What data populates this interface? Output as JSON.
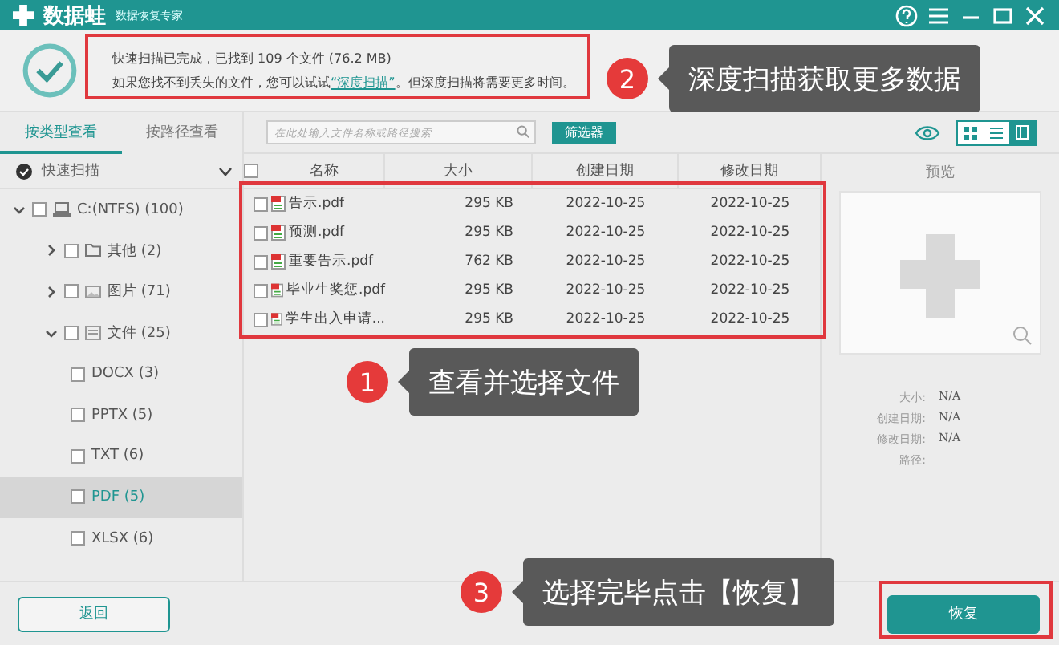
{
  "title_bar": {
    "logo": "数据蛙",
    "subtitle": "数据恢复专家"
  },
  "scan_summary": {
    "line_1": "快速扫描已完成，已找到 109 个文件 (76.2 MB)",
    "line_2_before": "如果您找不到丢失的文件，您可以试试",
    "link": "“深度扫描”",
    "line_2_after": "。但深度扫描将需要更多时间。"
  },
  "sidebar": {
    "tabs": [
      {
        "label": "按类型查看",
        "selected": true
      },
      {
        "label": "按路径查看",
        "selected": false
      }
    ],
    "scan_select": {
      "label": "快速扫描"
    },
    "tree": [
      {
        "label": "C:(NTFS) (100)",
        "kind": "drive",
        "expanded": true,
        "selected": false,
        "children": [
          {
            "label": "其他 (2)",
            "kind": "folder",
            "expanded": false,
            "selected": false
          },
          {
            "label": "图片 (71)",
            "kind": "image",
            "expanded": false,
            "selected": false
          },
          {
            "label": "文件 (25)",
            "kind": "document",
            "expanded": true,
            "selected": false,
            "children": [
              {
                "label": "DOCX (3)",
                "selected": false
              },
              {
                "label": "PPTX (5)",
                "selected": false
              },
              {
                "label": "TXT (6)",
                "selected": false
              },
              {
                "label": "PDF (5)",
                "selected": true
              },
              {
                "label": "XLSX (6)",
                "selected": false
              }
            ]
          }
        ]
      }
    ]
  },
  "search": {
    "placeholder": "在此处输入文件名称或路径搜索"
  },
  "filter_button": "筛选器",
  "view_toggles": [
    {
      "kind": "grid",
      "selected": false
    },
    {
      "kind": "list",
      "selected": false
    },
    {
      "kind": "preview",
      "selected": true
    }
  ],
  "table": {
    "select_all": {
      "checked": false
    },
    "columns": [
      "名称",
      "大小",
      "创建日期",
      "修改日期"
    ],
    "rows": [
      {
        "name": "告示.pdf",
        "size": "295 KB",
        "created": "2022-10-25",
        "modified": "2022-10-25",
        "checked": false
      },
      {
        "name": "预测.pdf",
        "size": "295 KB",
        "created": "2022-10-25",
        "modified": "2022-10-25",
        "checked": false
      },
      {
        "name": "重要告示.pdf",
        "size": "762 KB",
        "created": "2022-10-25",
        "modified": "2022-10-25",
        "checked": false
      },
      {
        "name": "毕业生奖惩.pdf",
        "size": "295 KB",
        "created": "2022-10-25",
        "modified": "2022-10-25",
        "checked": false
      },
      {
        "name": "学生出入申请...",
        "size": "295 KB",
        "created": "2022-10-25",
        "modified": "2022-10-25",
        "checked": false
      }
    ]
  },
  "preview": {
    "title": "预览",
    "fields": [
      {
        "label": "大小:",
        "value": "N/A"
      },
      {
        "label": "创建日期:",
        "value": "N/A"
      },
      {
        "label": "修改日期:",
        "value": "N/A"
      },
      {
        "label": "路径:"
      }
    ]
  },
  "back_button": "返回",
  "recover_button": "恢复",
  "annotations": [
    {
      "number": "2",
      "text": "深度扫描获取更多数据"
    },
    {
      "number": "1",
      "text": "查看并选择文件"
    },
    {
      "number": "3",
      "text": "选择完毕点击【恢复】"
    }
  ]
}
